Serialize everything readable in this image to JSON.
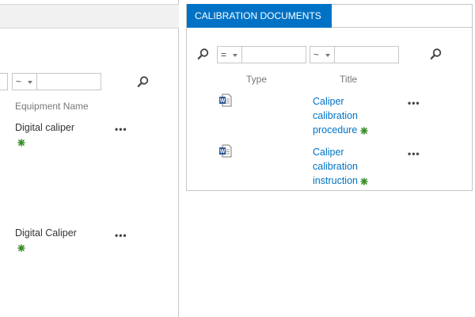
{
  "left_panel": {
    "filter_operator": "~",
    "column_header": "Equipment Name",
    "items": [
      {
        "title": "Digital caliper"
      },
      {
        "title": "Digital Caliper"
      }
    ]
  },
  "right_panel": {
    "tab_label": "CALIBRATION DOCUMENTS",
    "filter": {
      "operator1": "=",
      "operator2": "~"
    },
    "columns": {
      "type": "Type",
      "title": "Title"
    },
    "items": [
      {
        "title_line1": "Caliper",
        "title_line2": "calibration",
        "title_line3": "procedure"
      },
      {
        "title_line1": "Caliper",
        "title_line2": "calibration",
        "title_line3": "instruction"
      }
    ]
  },
  "icons": {
    "search": "search-icon",
    "new": "new-item-icon",
    "word": "word-document-icon",
    "more": "ellipsis-icon"
  },
  "colors": {
    "accent": "#0072c6",
    "new_icon": "#3a8e2a"
  }
}
